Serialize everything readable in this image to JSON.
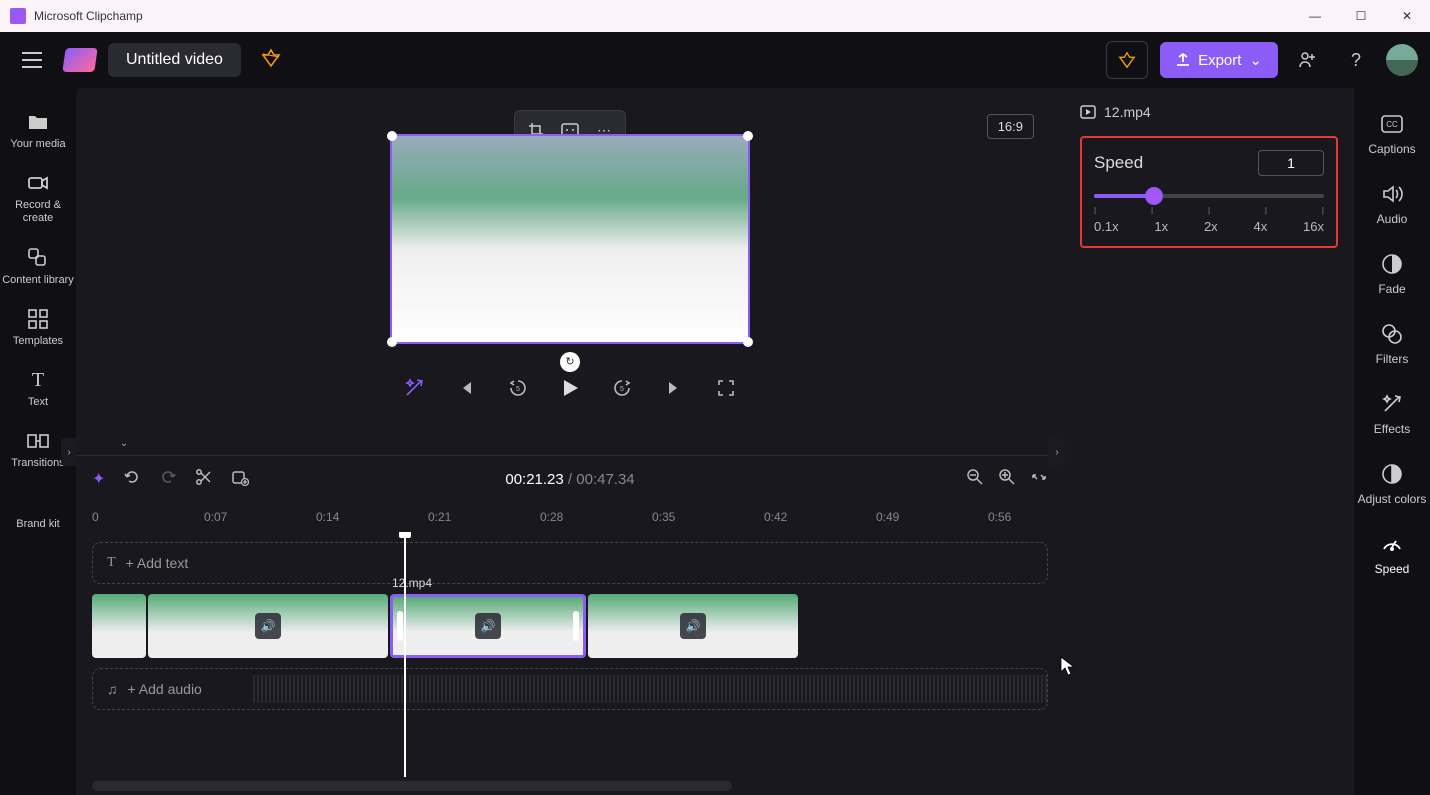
{
  "titlebar": {
    "app_name": "Microsoft Clipchamp"
  },
  "header": {
    "title": "Untitled video",
    "export_label": "Export"
  },
  "leftnav": {
    "items": [
      {
        "label": "Your media"
      },
      {
        "label": "Record & create"
      },
      {
        "label": "Content library"
      },
      {
        "label": "Templates"
      },
      {
        "label": "Text"
      },
      {
        "label": "Transitions"
      },
      {
        "label": "Brand kit"
      }
    ]
  },
  "preview": {
    "aspect_ratio": "16:9"
  },
  "timeline": {
    "current_time": "00:21.23",
    "duration": "00:47.34",
    "ruler": [
      "0",
      "0:07",
      "0:14",
      "0:21",
      "0:28",
      "0:35",
      "0:42",
      "0:49",
      "0:56"
    ],
    "add_text": "+ Add text",
    "add_audio": "+ Add audio",
    "clip_name": "12.mp4"
  },
  "rightpanel": {
    "clip_name": "12.mp4",
    "speed_label": "Speed",
    "speed_value": "1",
    "slider_marks": [
      "0.1x",
      "1x",
      "2x",
      "4x",
      "16x"
    ]
  },
  "rightnav": {
    "items": [
      {
        "label": "Captions"
      },
      {
        "label": "Audio"
      },
      {
        "label": "Fade"
      },
      {
        "label": "Filters"
      },
      {
        "label": "Effects"
      },
      {
        "label": "Adjust colors"
      },
      {
        "label": "Speed"
      }
    ]
  }
}
